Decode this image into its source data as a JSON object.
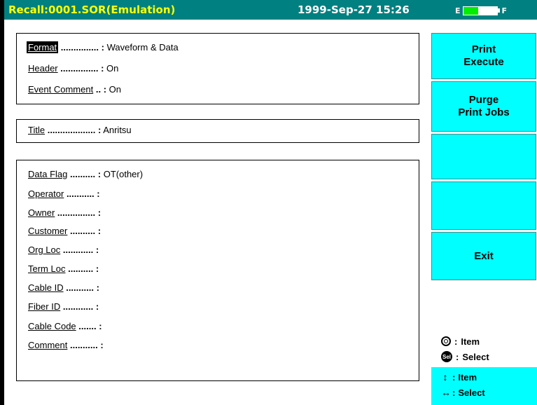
{
  "window": {
    "title": "Recall:0001.SOR(Emulation)",
    "datetime": "1999-Sep-27 15:26",
    "battery": {
      "empty_label": "E",
      "full_label": "F",
      "level": 0.45,
      "color": "#00ee00"
    }
  },
  "format_panel": {
    "rows": [
      {
        "label": "Format",
        "dots": "...............",
        "sep": ":",
        "value": "Waveform & Data",
        "selected": true
      },
      {
        "label": "Header",
        "dots": "...............",
        "sep": ":",
        "value": "On"
      },
      {
        "label": "Event Comment",
        "dots": "..",
        "sep": ":",
        "value": "On"
      }
    ]
  },
  "title_panel": {
    "rows": [
      {
        "label": "Title",
        "dots": "...................",
        "sep": ":",
        "value": "Anritsu"
      }
    ]
  },
  "info_panel": {
    "rows": [
      {
        "label": "Data Flag",
        "dots": "..........",
        "sep": ":",
        "value": "OT(other)"
      },
      {
        "label": "Operator",
        "dots": "...........",
        "sep": ":",
        "value": ""
      },
      {
        "label": "Owner",
        "dots": "...............",
        "sep": ":",
        "value": ""
      },
      {
        "label": "Customer",
        "dots": "..........",
        "sep": ":",
        "value": ""
      },
      {
        "label": "Org Loc",
        "dots": "............",
        "sep": ":",
        "value": ""
      },
      {
        "label": "Term Loc",
        "dots": "..........",
        "sep": ":",
        "value": ""
      },
      {
        "label": "Cable ID",
        "dots": "...........",
        "sep": ":",
        "value": ""
      },
      {
        "label": "Fiber ID",
        "dots": "............",
        "sep": ":",
        "value": ""
      },
      {
        "label": "Cable Code",
        "dots": ".......",
        "sep": ":",
        "value": ""
      },
      {
        "label": "Comment",
        "dots": "...........",
        "sep": ":",
        "value": ""
      }
    ]
  },
  "softkeys": [
    {
      "line1": "Print",
      "line2": "Execute"
    },
    {
      "line1": "Purge",
      "line2": "Print Jobs"
    },
    {
      "line1": "",
      "line2": ""
    },
    {
      "line1": "",
      "line2": ""
    },
    {
      "line1": "Exit",
      "line2": ""
    }
  ],
  "legend": {
    "knob_sep": ":",
    "knob_text": "Item",
    "sel_icon_text": "Sel",
    "sel_sep": ":",
    "sel_text": "Select"
  },
  "key_hints": {
    "updown_sep": ":",
    "updown_text": "Item",
    "leftright_sep": ":",
    "leftright_text": "Select"
  },
  "colors": {
    "titlebar": "#008080",
    "title_text": "#ffff00",
    "softkey": "#00ffff"
  }
}
